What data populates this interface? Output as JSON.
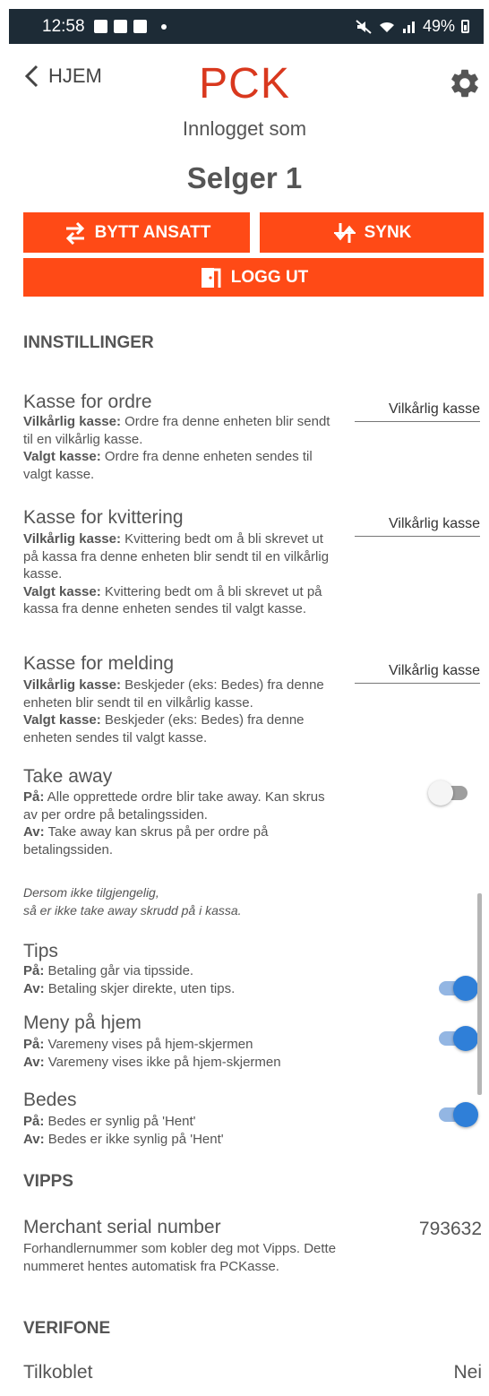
{
  "status_bar": {
    "time": "12:58",
    "battery": "49%"
  },
  "header": {
    "back_label": "HJEM",
    "title": "PCK"
  },
  "user": {
    "logged_in_label": "Innlogget som",
    "name": "Selger 1"
  },
  "buttons": {
    "swap_employee": "BYTT ANSATT",
    "sync": "SYNK",
    "logout": "LOGG UT"
  },
  "sections": {
    "settings": "INNSTILLINGER",
    "vipps": "VIPPS",
    "verifone": "VERIFONE"
  },
  "settings": {
    "order_register": {
      "title": "Kasse for ordre",
      "any_label": "Vilkårlig kasse:",
      "any_text": " Ordre fra denne enheten blir sendt til en vilkårlig kasse.",
      "chosen_label": "Valgt kasse:",
      "chosen_text": " Ordre fra denne enheten sendes til valgt kasse.",
      "value": "Vilkårlig kasse"
    },
    "receipt_register": {
      "title": "Kasse for kvittering",
      "any_label": "Vilkårlig kasse:",
      "any_text": " Kvittering bedt om å bli skrevet ut på kassa fra denne enheten blir sendt til en vilkårlig kasse.",
      "chosen_label": "Valgt kasse:",
      "chosen_text": " Kvittering bedt om å bli skrevet ut på kassa fra denne enheten sendes til valgt kasse.",
      "value": "Vilkårlig kasse"
    },
    "message_register": {
      "title": "Kasse for melding",
      "any_label": "Vilkårlig kasse:",
      "any_text": " Beskjeder (eks: Bedes) fra denne enheten blir sendt til en vilkårlig kasse.",
      "chosen_label": "Valgt kasse:",
      "chosen_text": " Beskjeder (eks: Bedes) fra denne enheten sendes til valgt kasse.",
      "value": "Vilkårlig kasse"
    },
    "take_away": {
      "title": "Take away",
      "on_label": "På:",
      "on_text": " Alle opprettede ordre blir take away. Kan skrus av per ordre på betalingssiden.",
      "off_label": "Av:",
      "off_text": " Take away kan skrus på per ordre på betalingssiden.",
      "note_line1": "Dersom ikke tilgjengelig,",
      "note_line2": "så er ikke take away skrudd på i kassa.",
      "enabled": false
    },
    "tips": {
      "title": "Tips",
      "on_label": "På:",
      "on_text": " Betaling går via tipsside.",
      "off_label": "Av:",
      "off_text": " Betaling skjer direkte, uten tips.",
      "enabled": true
    },
    "menu_home": {
      "title": "Meny på hjem",
      "on_label": "På:",
      "on_text": " Varemeny vises på hjem-skjermen",
      "off_label": "Av:",
      "off_text": " Varemeny vises ikke på hjem-skjermen",
      "enabled": true
    },
    "bedes": {
      "title": "Bedes",
      "on_label": "På:",
      "on_text": " Bedes er synlig på 'Hent'",
      "off_label": "Av:",
      "off_text": " Bedes er ikke synlig på 'Hent'",
      "enabled": true
    }
  },
  "vipps": {
    "title": "Merchant serial number",
    "desc": "Forhandlernummer som kobler deg mot Vipps. Dette nummeret hentes automatisk fra PCKasse.",
    "value": "793632"
  },
  "verifone": {
    "title": "Tilkoblet",
    "value": "Nei"
  },
  "colors": {
    "brand": "#d9381e",
    "button": "#ff4a16",
    "toggle_on": "#2f7fd8",
    "status_bar": "#1d2b36"
  }
}
